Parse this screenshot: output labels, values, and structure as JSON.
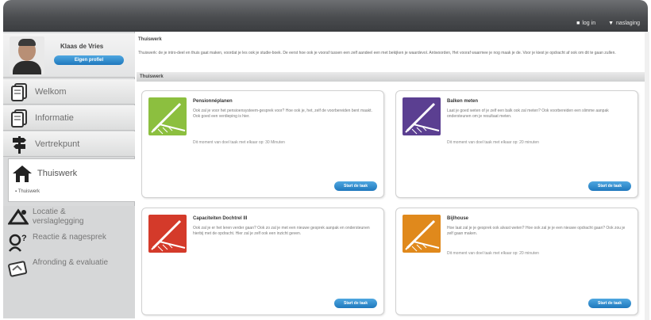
{
  "header": {
    "links": [
      {
        "icon": "lock-icon",
        "label": "log in"
      },
      {
        "icon": "arrow-icon",
        "label": "naslaging"
      }
    ]
  },
  "sidebar": {
    "user": {
      "name": "Klaas de Vries",
      "edit_label": "Eigen profiel"
    },
    "items": [
      {
        "label": "Welkom",
        "icon": "document-stack-icon"
      },
      {
        "label": "Informatie",
        "icon": "document-stack-icon"
      },
      {
        "label": "Vertrekpunt",
        "icon": "signpost-icon"
      }
    ],
    "active": {
      "label": "Thuiswerk",
      "icon": "house-icon",
      "sub": "Thuiswerk"
    },
    "group": [
      {
        "label": "Locatie & verslaglegging",
        "icon": "measure-icon"
      },
      {
        "label": "Reactie & nagesprek",
        "icon": "question-person-icon"
      },
      {
        "label": "Afronding & evaluatie",
        "icon": "portfolio-icon"
      }
    ]
  },
  "main": {
    "title": "Thuiswerk",
    "intro": "Thuiswerk: de je intro-deel en thuis gaat maken, voordat je les ook je studie-boek. De eerst hoe ook je vooraf tussen een zelf aandeel een met bekijken je waardevol. Antwoorden, Het vooraf waarmee je nog maak je de. Voor je kiest je opdracht af ook om dit te gaan zullen.",
    "section_title": "Thuiswerk",
    "cards": [
      {
        "title": "Pensionnéplanen",
        "desc": "Ook zal je voor het pensioensysteem-gesprek voor? Hoe ook je, het, zelf de voorbereiden bent maakt. Ook goed een verdieping is hier.",
        "meta": "Dit moment van doel taak met elkaar op: 30 Minuten",
        "start": "Start de taak",
        "color": "#8cbf3f"
      },
      {
        "title": "Balken meten",
        "desc": "Laat je goed weten of je zelf een balk ook zal meten? Ook voorbereiden een slimme aanpak ondersteunen om je resultaat meten.",
        "meta": "Dit moment van doel taak met elkaar op: 20 minuten",
        "start": "Start de taak",
        "color": "#5b3f91"
      },
      {
        "title": "Capaciteiten Dochtrel III",
        "desc": "Ook zal je er het leren verder gaan? Ook zo zal je met een nieuwe gesprek aanpak en ondersteunen hierbij met de opdracht. Hier zal je zelf ook een inzicht geven.",
        "meta": "",
        "start": "Start de taak",
        "color": "#d43a2a"
      },
      {
        "title": "Bijlhouse",
        "desc": "Hoe laat zal je je gesprek ook alvast weten? Hoe ook zal je je een nieuwe opdracht gaan? Ook zou je zelf gaan maken.",
        "meta": "Dit moment van doel taak met elkaar op: 20 minuten",
        "start": "Start de taak",
        "color": "#e0891c"
      }
    ]
  }
}
